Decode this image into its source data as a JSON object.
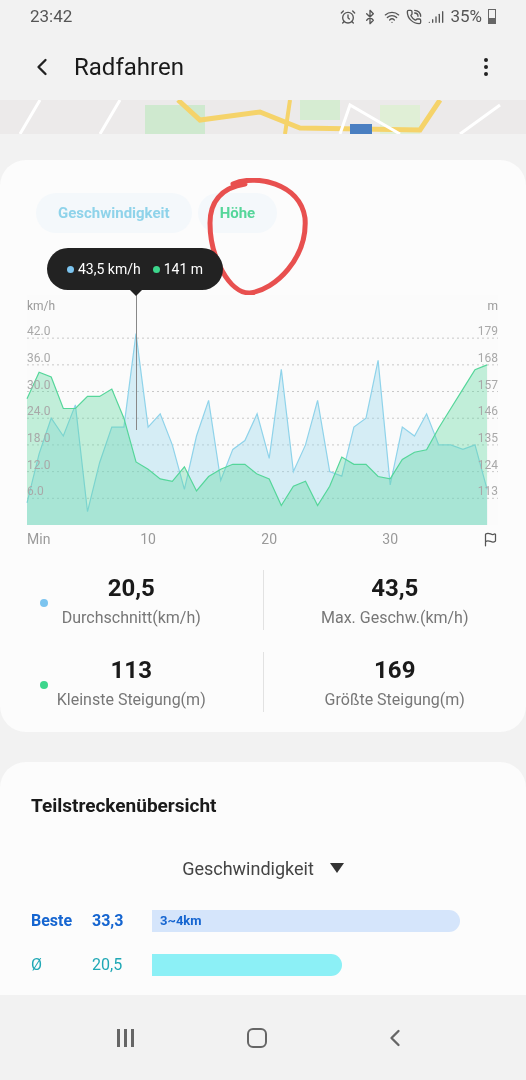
{
  "status_bar": {
    "time": "23:42",
    "battery": "35%"
  },
  "header": {
    "title": "Radfahren"
  },
  "tooltip": {
    "speed": "43,5 km/h",
    "altitude": "141 m"
  },
  "chart_data": {
    "type": "area",
    "grid": true,
    "xlabel": "Min",
    "ylabel": "km/h",
    "y2label": "m",
    "x": [
      0,
      1,
      2,
      3,
      4,
      5,
      6,
      7,
      8,
      9,
      10,
      11,
      12,
      13,
      14,
      15,
      16,
      17,
      18,
      19,
      20,
      21,
      22,
      23,
      24,
      25,
      26,
      27,
      28,
      29,
      30,
      31,
      32,
      33,
      34,
      35,
      36,
      37,
      38
    ],
    "xlim": [
      0,
      38.9
    ],
    "ylim": [
      0,
      51.7
    ],
    "y2lim": [
      102,
      196.8
    ],
    "xticks": [
      10,
      20,
      30
    ],
    "yticks": [
      {
        "value": 6,
        "label": "6.0"
      },
      {
        "value": 12,
        "label": "12.0"
      },
      {
        "value": 18,
        "label": "18.0"
      },
      {
        "value": 24,
        "label": "24.0"
      },
      {
        "value": 30,
        "label": "30.0"
      },
      {
        "value": 36,
        "label": "36.0"
      },
      {
        "value": 42,
        "label": "42.0"
      }
    ],
    "y2ticks": [
      113,
      124,
      135,
      146,
      157,
      168,
      179
    ],
    "series": [
      {
        "name": "Geschwindigkeit",
        "color": "#8fd3ea",
        "values": [
          5,
          16,
          24,
          20,
          27,
          3,
          14,
          22,
          22,
          43,
          22,
          25,
          18,
          8,
          20,
          28,
          10,
          17,
          19,
          25,
          15,
          35,
          12,
          18,
          28,
          12,
          11,
          22,
          24,
          37,
          9,
          22,
          20,
          25,
          18,
          18,
          17,
          18,
          8
        ]
      },
      {
        "name": "Höhe",
        "color": "#55d69a",
        "axis": "y2",
        "values": [
          154,
          165,
          163,
          150,
          150,
          155,
          155,
          158,
          146,
          128,
          125,
          121,
          120,
          126,
          116,
          122,
          125,
          127,
          127,
          123,
          121,
          110,
          118,
          120,
          110,
          118,
          130,
          127,
          127,
          122,
          121,
          129,
          132,
          133,
          142,
          150,
          158,
          166,
          168
        ]
      }
    ]
  },
  "stats": [
    {
      "color": "#7cc4ef",
      "items": [
        {
          "value": "20,5",
          "label": "Durchschnitt(km/h)"
        },
        {
          "value": "43,5",
          "label": "Max. Geschw.(km/h)"
        }
      ]
    },
    {
      "color": "#3dd68c",
      "items": [
        {
          "value": "113",
          "label": "Kleinste Steigung(m)"
        },
        {
          "value": "169",
          "label": "Größte Steigung(m)"
        }
      ]
    }
  ],
  "splits": {
    "title": "Teilstreckenübersicht",
    "dropdown": "Geschwindigkeit",
    "rows": [
      {
        "kind": "best",
        "label": "Beste",
        "value": "33,3",
        "bar_label": "3~4km"
      },
      {
        "kind": "average",
        "label": "Ø",
        "value": "20,5"
      }
    ]
  }
}
